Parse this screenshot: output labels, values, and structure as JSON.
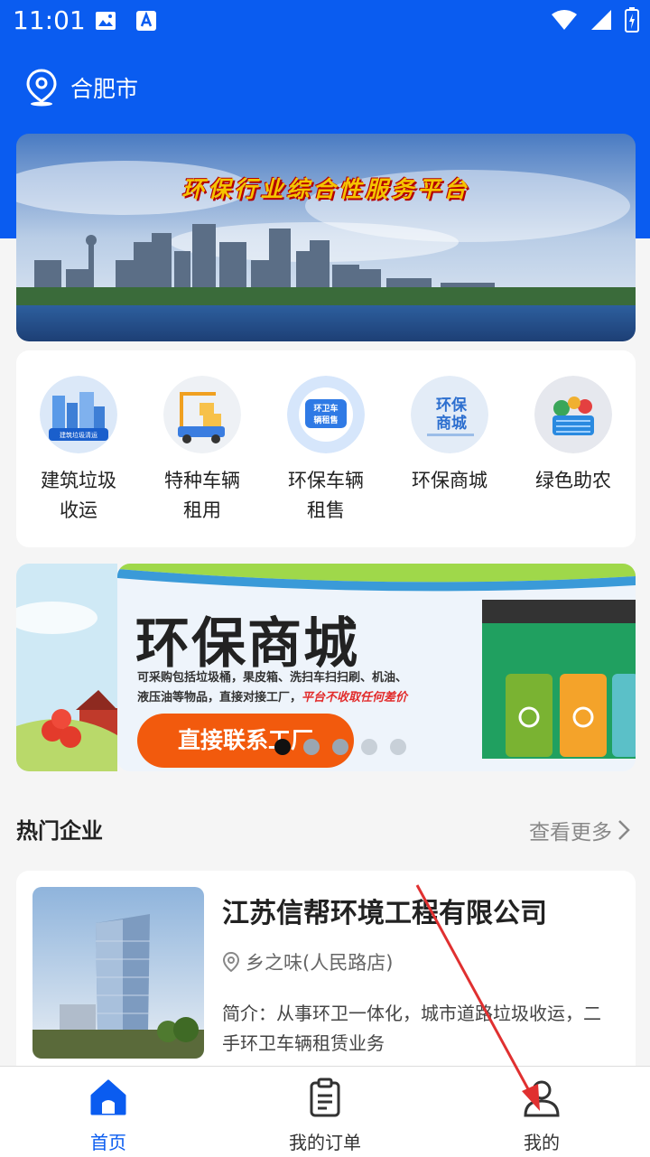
{
  "status_bar": {
    "time": "11:01"
  },
  "location": {
    "city": "合肥市"
  },
  "banner": {
    "title": "环保行业综合性服务平台"
  },
  "menu": [
    {
      "label": "建筑垃圾收运",
      "line1": "建筑垃圾",
      "line2": "收运",
      "icon_text": "建筑垃圾清运"
    },
    {
      "label": "特种车辆租用",
      "line1": "特种车辆",
      "line2": "租用",
      "icon_text": ""
    },
    {
      "label": "环保车辆租售",
      "line1": "环保车辆",
      "line2": "租售",
      "icon_text_1": "环卫车",
      "icon_text_2": "辆租售"
    },
    {
      "label": "环保商城",
      "line1": "环保商城",
      "line2": "",
      "icon_text_1": "环保",
      "icon_text_2": "商城"
    },
    {
      "label": "绿色助农",
      "line1": "绿色助农",
      "line2": "",
      "icon_text": ""
    }
  ],
  "promo": {
    "title": "环保商城",
    "desc_1": "可采购包括垃圾桶，果皮箱、洗扫车扫扫刷、机油、",
    "desc_2": "液压油等物品，直接对接工厂，",
    "desc_red": "平台不收取任何差价",
    "button": "直接联系工厂",
    "slide_count": 5,
    "active_slide": 1
  },
  "hot": {
    "title": "热门企业",
    "more": "查看更多"
  },
  "company": {
    "name": "江苏信帮环境工程有限公司",
    "address": "乡之味(人民路店)",
    "desc": "简介：从事环卫一体化，城市道路垃圾收运，二手环卫车辆租赁业务"
  },
  "tabs": [
    {
      "label": "首页",
      "icon": "home-icon",
      "active": true
    },
    {
      "label": "我的订单",
      "icon": "clipboard-icon",
      "active": false
    },
    {
      "label": "我的",
      "icon": "person-icon",
      "active": false
    }
  ],
  "colors": {
    "primary": "#0a5cf0",
    "orange": "#f25a0d",
    "accent_red": "#e22b2b"
  }
}
